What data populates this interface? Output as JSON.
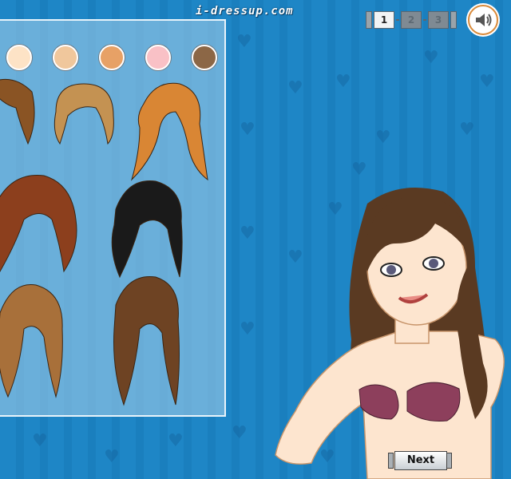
{
  "header": {
    "site_title": "i-dressup.com",
    "steps": [
      {
        "label": "1",
        "active": true
      },
      {
        "label": "2",
        "active": false
      },
      {
        "label": "3",
        "active": false
      }
    ],
    "sound_icon": "speaker-icon"
  },
  "panel": {
    "skin_swatches": [
      {
        "color": "#fde3c6"
      },
      {
        "color": "#f0c79c"
      },
      {
        "color": "#e7a166"
      },
      {
        "color": "#f9c1c6"
      },
      {
        "color": "#8c6746"
      }
    ],
    "hairstyles": [
      {
        "color": "#8a5424"
      },
      {
        "color": "#c49252"
      },
      {
        "color": "#d98634"
      },
      {
        "color": "#8c3f1d"
      },
      {
        "color": "#1a1a1a"
      },
      {
        "color": "#a8703a"
      },
      {
        "color": "#6e4323"
      }
    ]
  },
  "model": {
    "hair_color": "#5a3a22",
    "skin_color": "#fde5cf",
    "top_color": "#8d3f5c"
  },
  "footer": {
    "next_label": "Next"
  }
}
